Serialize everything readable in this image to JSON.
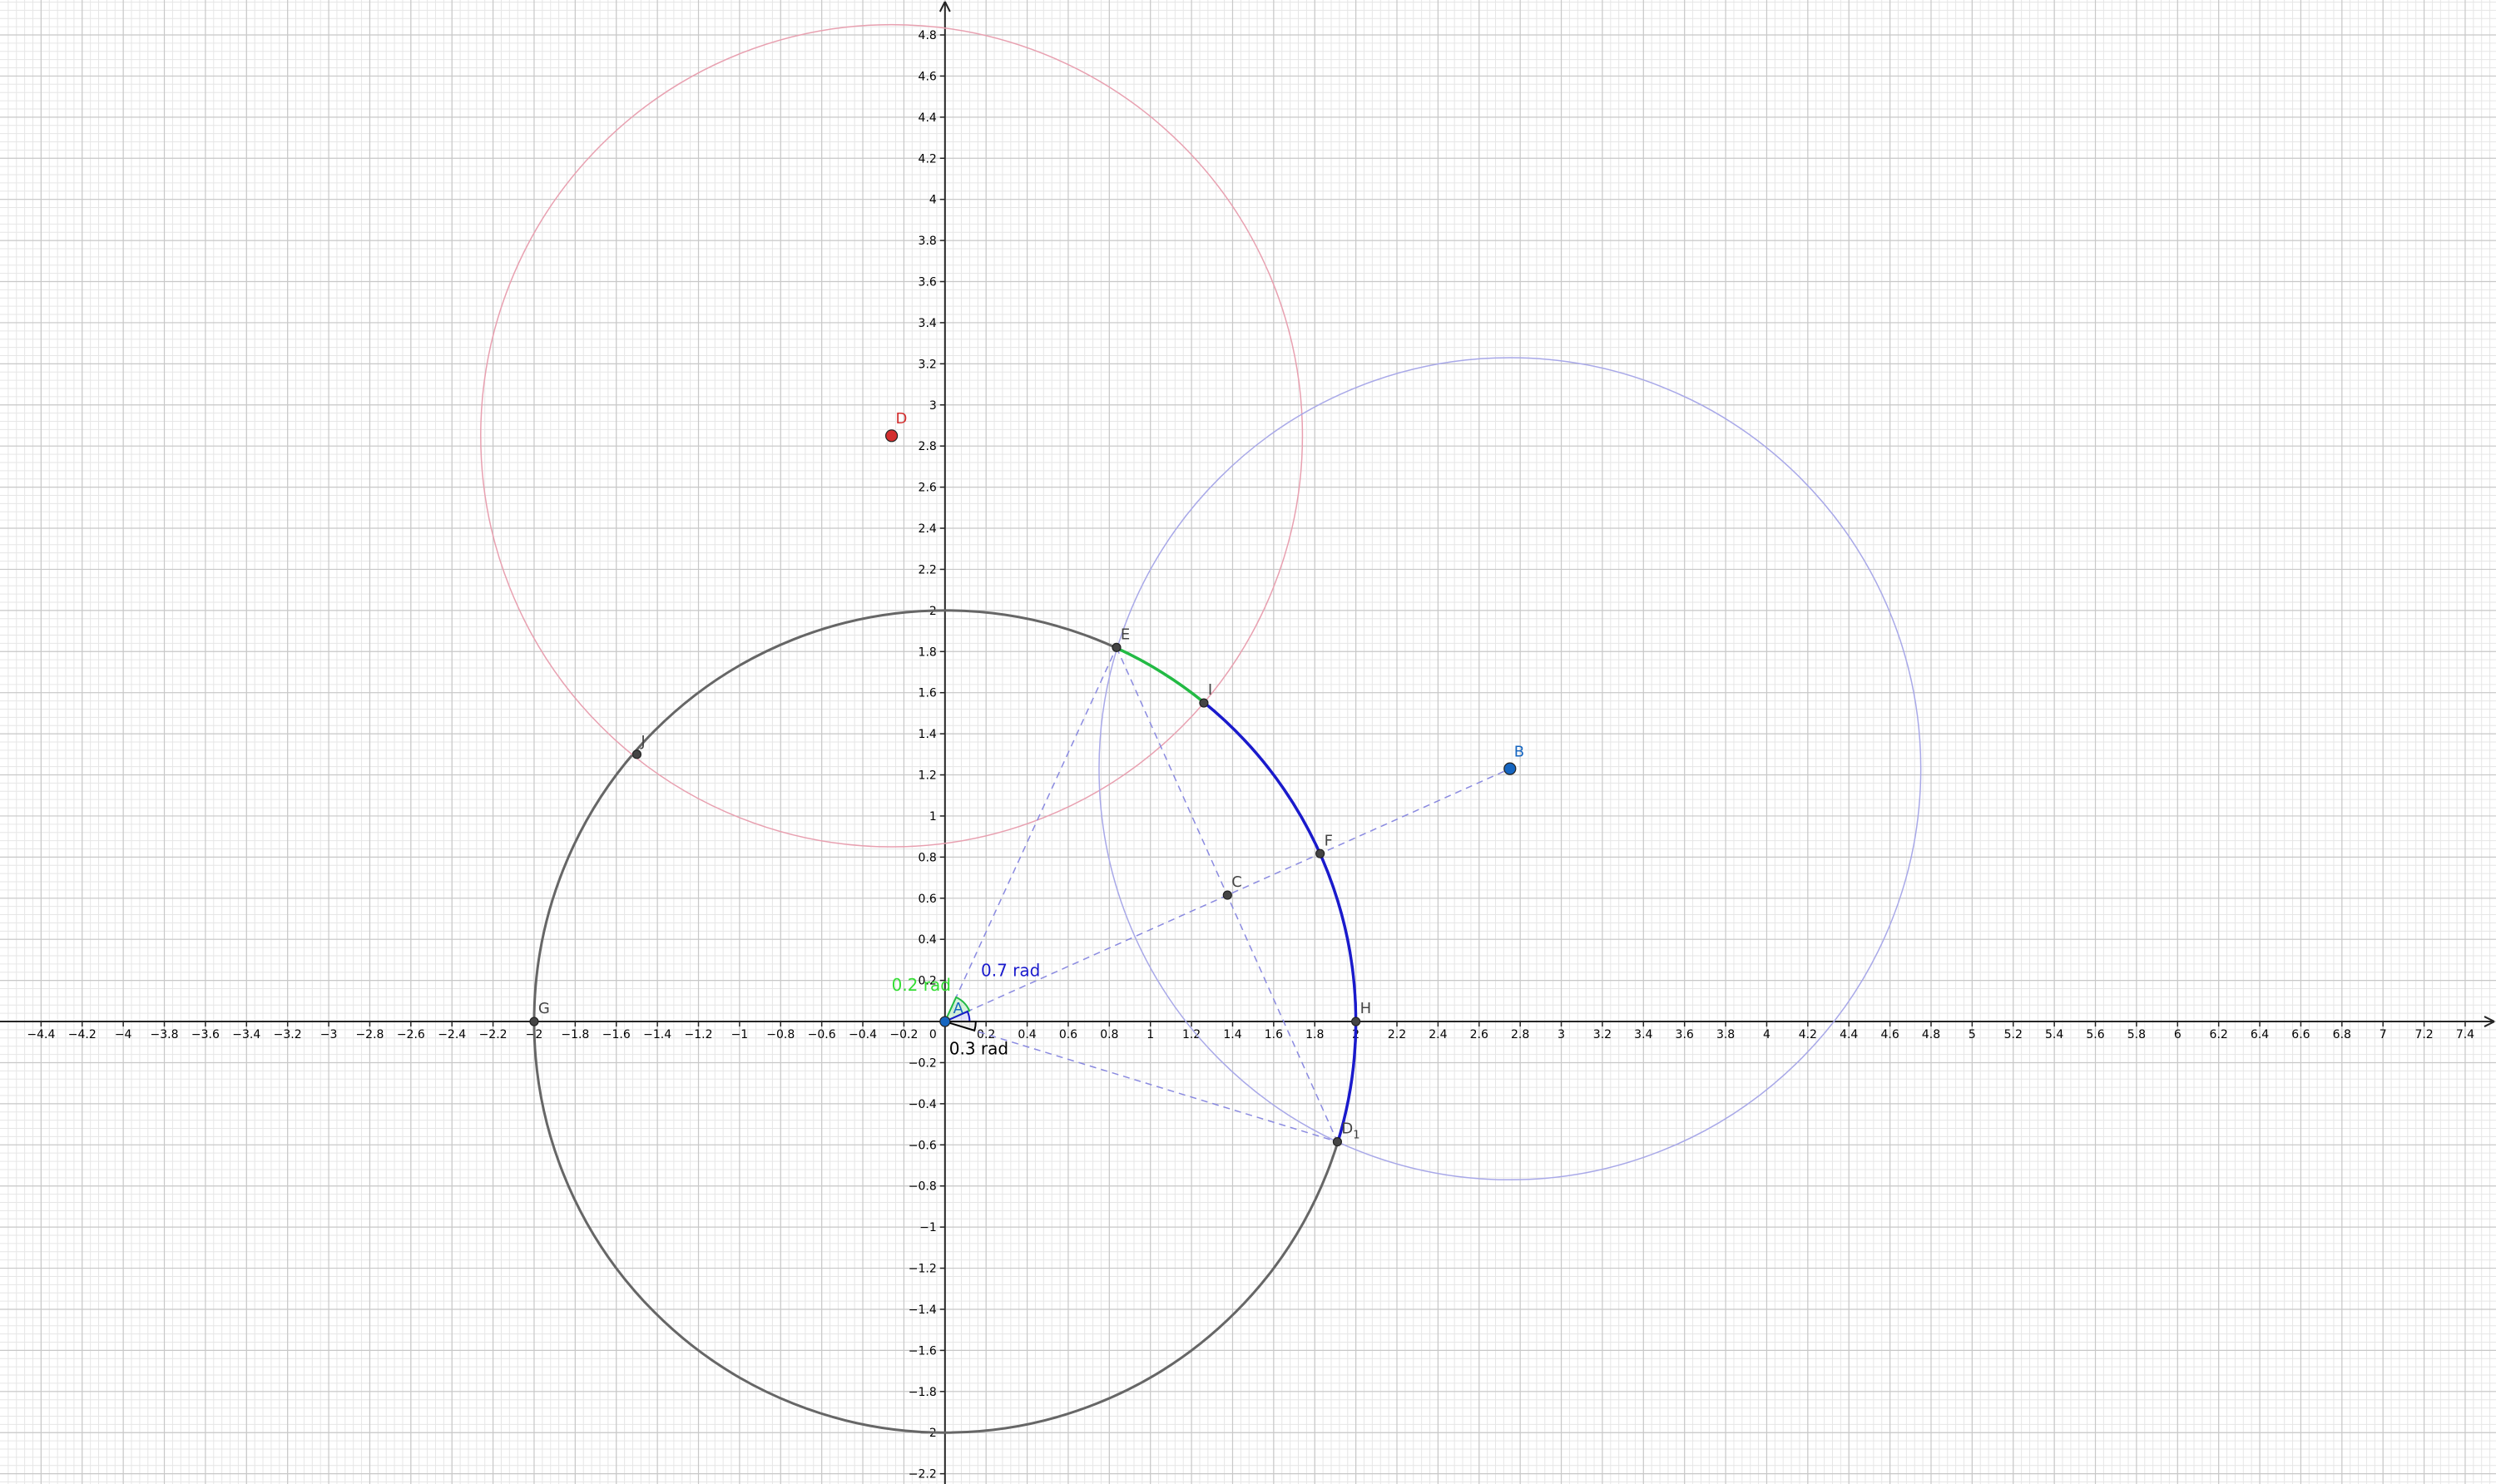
{
  "view": {
    "x_range": [
      -4.6,
      7.55
    ],
    "y_range": [
      -2.25,
      4.97
    ],
    "x_tick_step": 0.2,
    "y_tick_step": 0.2,
    "minor_grid_step": 0.04,
    "major_grid_step": 0.2,
    "grid": true,
    "colors": {
      "minor_grid": "#e6e6e6",
      "major_grid": "#c8c8c8",
      "axis": "#252525",
      "background": "#ffffff"
    }
  },
  "points": [
    {
      "id": "A",
      "label": "A",
      "x": 0,
      "y": 0,
      "color": "#1565c0",
      "size": 6,
      "label_color": "#1565c0",
      "label_dx": 0.04,
      "label_dy": 0.04
    },
    {
      "id": "B",
      "label": "B",
      "x": 2.75,
      "y": 1.23,
      "color": "#1565c0",
      "size": 7,
      "label_color": "#1565c0",
      "label_dx": 0.02,
      "label_dy": 0.06
    },
    {
      "id": "C",
      "label": "C",
      "x": 1.375,
      "y": 0.615,
      "color": "#444444",
      "size": 5,
      "label_color": "#444444",
      "label_dx": 0.02,
      "label_dy": 0.04
    },
    {
      "id": "D",
      "label": "D",
      "x": -0.26,
      "y": 2.85,
      "color": "#d32f2f",
      "size": 7,
      "label_color": "#d32f2f",
      "label_dx": 0.02,
      "label_dy": 0.06
    },
    {
      "id": "E",
      "label": "E",
      "x": 0.835,
      "y": 1.82,
      "color": "#444444",
      "size": 5,
      "label_color": "#444444",
      "label_dx": 0.02,
      "label_dy": 0.04
    },
    {
      "id": "F",
      "label": "F",
      "x": 1.826,
      "y": 0.817,
      "color": "#444444",
      "size": 5,
      "label_color": "#444444",
      "label_dx": 0.02,
      "label_dy": 0.04
    },
    {
      "id": "G",
      "label": "G",
      "x": -2,
      "y": 0,
      "color": "#444444",
      "size": 5,
      "label_color": "#444444",
      "label_dx": 0.02,
      "label_dy": 0.04
    },
    {
      "id": "H",
      "label": "H",
      "x": 2,
      "y": 0,
      "color": "#444444",
      "size": 5,
      "label_color": "#444444",
      "label_dx": 0.02,
      "label_dy": 0.04
    },
    {
      "id": "I",
      "label": "I",
      "x": 1.26,
      "y": 1.55,
      "color": "#444444",
      "size": 5,
      "label_color": "#444444",
      "label_dx": 0.02,
      "label_dy": 0.04
    },
    {
      "id": "J",
      "label": "J",
      "x": -1.5,
      "y": 1.3,
      "color": "#444444",
      "size": 5,
      "label_color": "#444444",
      "label_dx": 0.02,
      "label_dy": 0.04
    },
    {
      "id": "D1",
      "label": "D",
      "subscript": "1",
      "x": 1.91,
      "y": -0.585,
      "color": "#444444",
      "size": 5,
      "label_color": "#444444",
      "label_dx": 0.02,
      "label_dy": 0.04
    }
  ],
  "circles": [
    {
      "name": "circle-c",
      "cx": 0,
      "cy": 0,
      "r": 2,
      "color": "#666666",
      "width": 3
    },
    {
      "name": "circle-d",
      "cx": -0.26,
      "cy": 2.85,
      "r": 2,
      "color": "#e8a0b0",
      "width": 1.5
    },
    {
      "name": "circle-b",
      "cx": 2.75,
      "cy": 1.23,
      "r": 2,
      "color": "#a8a8e8",
      "width": 1.5
    }
  ],
  "arcs": [
    {
      "name": "arc-e-i",
      "cx": 0,
      "cy": 0,
      "r": 2,
      "from_deg": 51,
      "to_deg": 65.4,
      "color": "#22bb44",
      "width": 3.5
    },
    {
      "name": "arc-d1-i",
      "cx": 0,
      "cy": 0,
      "r": 2,
      "from_deg": -17,
      "to_deg": 51,
      "color": "#1a1acc",
      "width": 3.5
    }
  ],
  "segments": [
    {
      "name": "segment-a-b",
      "from": "A",
      "to": "B"
    },
    {
      "name": "segment-a-e",
      "from": "A",
      "to": "E"
    },
    {
      "name": "segment-e-d1",
      "from": "E",
      "to": "D1"
    },
    {
      "name": "segment-a-d1",
      "from": "A",
      "to": "D1"
    }
  ],
  "segment_style": {
    "color": "#8a8ae0",
    "width": 1.5,
    "dash": "8 6"
  },
  "angles": [
    {
      "name": "angle-green",
      "center": "A",
      "from_deg": 24.1,
      "to_deg": 65.4,
      "radius": 0.13,
      "color": "#22bb44",
      "fill": "rgba(34,187,68,0.18)",
      "label": "0.2 rad",
      "label_x": -0.26,
      "label_y": 0.15,
      "label_color": "#33dd33"
    },
    {
      "name": "angle-blue",
      "center": "A",
      "from_deg": 0,
      "to_deg": 24.1,
      "radius": 0.12,
      "color": "#1a1acc",
      "fill": "rgba(26,26,204,0.12)",
      "label": "0.7 rad",
      "label_x": 0.175,
      "label_y": 0.22,
      "label_color": "#1a1acc"
    },
    {
      "name": "angle-black",
      "center": "A",
      "from_deg": -17,
      "to_deg": 0,
      "radius": 0.15,
      "color": "#000000",
      "fill": "rgba(0,0,0,0.08)",
      "label": "0.3 rad",
      "label_x": 0.02,
      "label_y": -0.16,
      "label_color": "#000000"
    }
  ]
}
